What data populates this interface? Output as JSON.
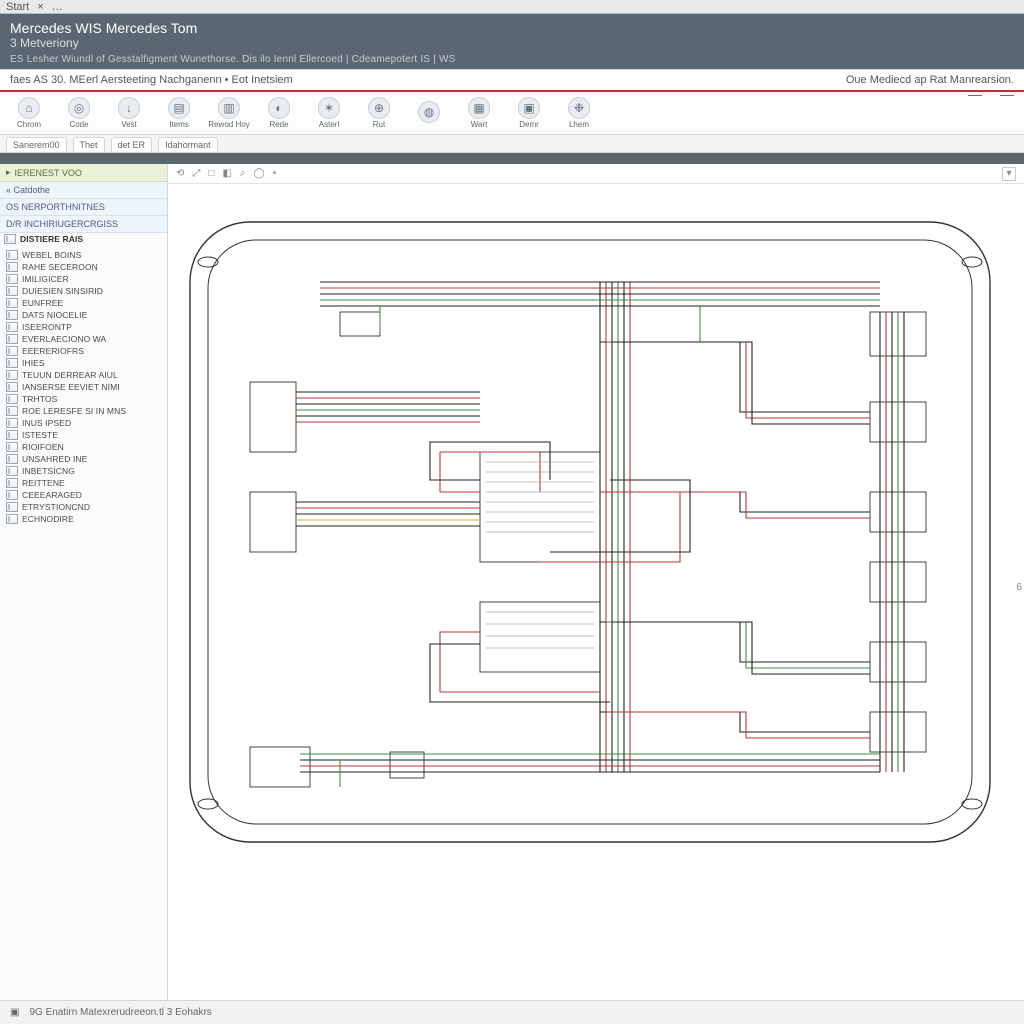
{
  "topbar": {
    "left1": "Start",
    "left2": "×",
    "left3": "…"
  },
  "header": {
    "title_line1": "Mercedes WIS Mercedes Tom",
    "title_line2": "3 Metveriony",
    "crumbs": "ES   Lesher Wiundl of Gesstalfigment Wunethorse. Dis ilo Iennl Ellercoed | Cdeamepotert IS | WS"
  },
  "ribbon_title": {
    "left": "faes AS 30. MEerl Aersteeting Nachganenn  •  Eot Inetsiem",
    "right": "Oue Mediecd ap Rat Manrearsion."
  },
  "ribbon": [
    {
      "icon": "⌂",
      "label": "Chrom"
    },
    {
      "icon": "◎",
      "label": "Code"
    },
    {
      "icon": "↓",
      "label": "Vest"
    },
    {
      "icon": "▤",
      "label": "Items"
    },
    {
      "icon": "▥",
      "label": "Rewod Hoy"
    },
    {
      "icon": "◐",
      "label": "Rede"
    },
    {
      "icon": "✶",
      "label": "Asterl"
    },
    {
      "icon": "⊕",
      "label": "Rut"
    },
    {
      "icon": "◍",
      "label": ""
    },
    {
      "icon": "▦",
      "label": "Wart"
    },
    {
      "icon": "▣",
      "label": "Demr"
    },
    {
      "icon": "❉",
      "label": "Lhem"
    }
  ],
  "tabs": [
    "Sanerem00",
    "Thet",
    "det ER",
    "Idahormant"
  ],
  "sidebar": {
    "head_icon": "▸",
    "head": "IERENEST VOO",
    "sub1": "« Catdothe",
    "sub2": "OS NERPORTHNITNES",
    "sub3": "D/R INCHIRIUGERCRGISS",
    "group": "DISTIERE RAlS",
    "items": [
      "WEBEL BOINS",
      "RAHE SECEROON",
      "IMILIGICER",
      "DUIESIEN SINSIRID",
      "EUNFREE",
      "DATS NIOCELIE",
      "ISEERONTP",
      "EVERLAECIONO WA",
      "EEERERIOFRS",
      "IHIES",
      "TEUUN DERREAR AIUL",
      "IANSERSE EEVIET NIMI",
      "TRHTOS",
      "ROE LERESFE SI IN MNS",
      "INUS IPSED",
      "ISTESTE",
      "RIOIFOEN",
      "UNSAHRED INE",
      "INBETSICNG",
      "REITTENE",
      "CEEEARAGED",
      "ETRYSTIONCND",
      "ECHNODIRE"
    ]
  },
  "mini_toolbar": [
    "⟲",
    "⤢",
    "□",
    "◧",
    "⌕",
    "◯",
    "•"
  ],
  "status": {
    "icon": "▣",
    "text": "9G Enatirn  Matexrerudreeon.tl  3 Eohakrs"
  },
  "right_gutter": "6",
  "colors": {
    "accent_red": "#c03030",
    "wire_red": "#b33a3a",
    "wire_green": "#3f8f3f",
    "wire_black": "#222",
    "wire_yellow": "#c9b23a"
  }
}
